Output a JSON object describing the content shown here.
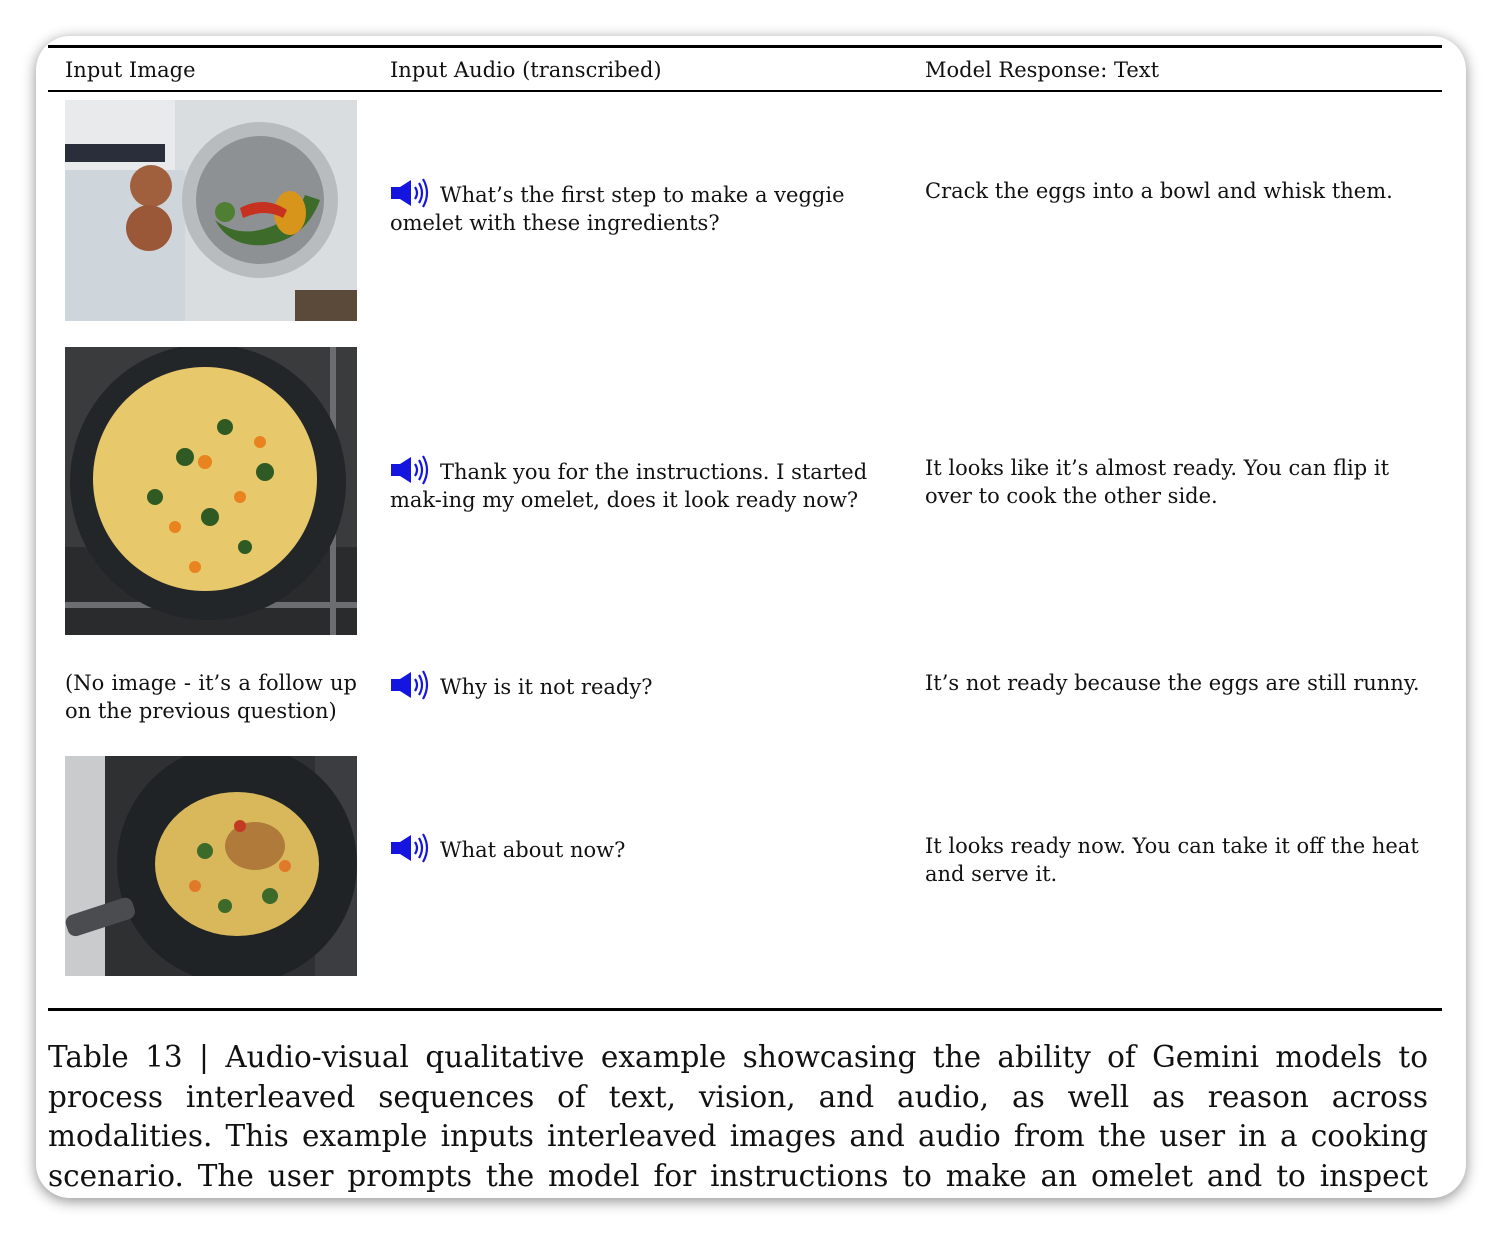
{
  "headers": {
    "image": "Input Image",
    "audio": "Input Audio (transcribed)",
    "response": "Model Response: Text"
  },
  "rows": [
    {
      "image": "ingredients-photo",
      "audio": "What’s the first step to make a veggie omelet with these ingredients?",
      "response": "Crack the eggs into a bowl and whisk them."
    },
    {
      "image": "raw-omelet-photo",
      "audio": "Thank you for the instructions. I started mak-ing my omelet, does it look ready now?",
      "response": "It looks like it’s almost ready. You can flip it over to cook the other side."
    },
    {
      "image_note": "(No image - it’s a follow up on the previous question)",
      "audio": "Why is it not ready?",
      "response": "It’s not ready because the eggs are still runny."
    },
    {
      "image": "cooked-omelet-photo",
      "audio": "What about now?",
      "response": "It looks ready now. You can take it off the heat and serve it."
    }
  ],
  "icons": {
    "audio": "speaker-icon"
  },
  "colors": {
    "speaker": "#1515e0",
    "rule": "#000000"
  },
  "caption": {
    "label": "Table 13 |",
    "text": "Audio-visual qualitative example showcasing the ability of Gemini models to process interleaved sequences of text, vision, and audio, as well as reason across modalities. This example inputs interleaved images and audio from the user in a cooking scenario. The user prompts the model for instructions to make an omelet and to inspect whether it is fully cooked."
  }
}
